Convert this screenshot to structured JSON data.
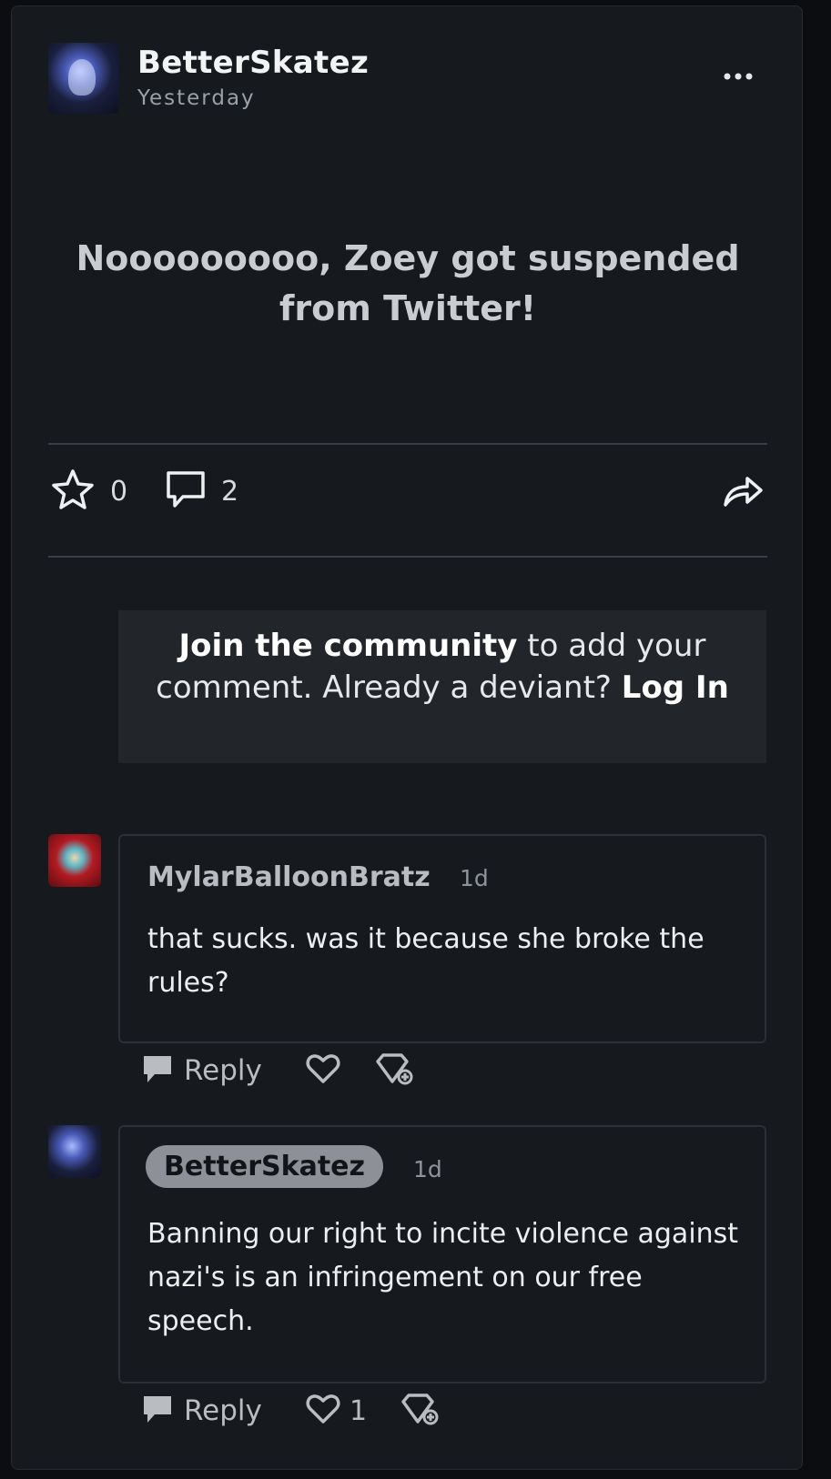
{
  "post": {
    "author": "BetterSkatez",
    "timestamp": "Yesterday",
    "more_icon": "ellipsis-icon",
    "title": "Nooooooooo, Zoey got suspended from Twitter!",
    "favorites_count": "0",
    "comments_count": "2"
  },
  "join": {
    "link_text": "Join the community",
    "middle_text": " to add your comment. Already a deviant? ",
    "login_text": "Log In"
  },
  "comments": [
    {
      "username": "MylarBalloonBratz",
      "time": "1d",
      "text": "that sucks. was it because she broke the rules?",
      "reply_label": "Reply",
      "like_count": ""
    },
    {
      "username": "BetterSkatez",
      "time": "1d",
      "text": "Banning our right to incite violence against nazi's is an infringement on our free speech.",
      "reply_label": "Reply",
      "like_count": "1"
    }
  ],
  "colors": {
    "background": "#0b0d10",
    "card": "#16191e",
    "join_box": "#22262b",
    "author_pill": "#8d9096"
  }
}
